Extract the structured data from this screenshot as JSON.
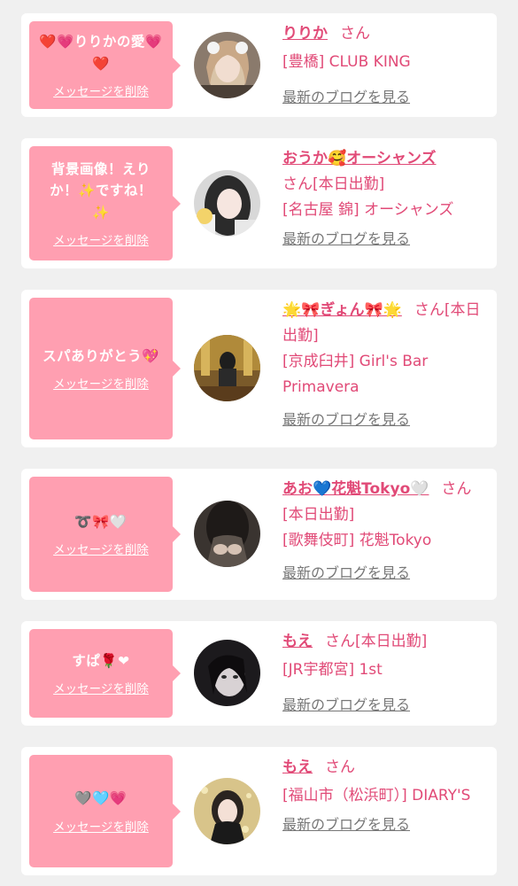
{
  "colors": {
    "page_bg": "#f0f0f0",
    "card_bg": "#ffffff",
    "bubble_bg": "#ff9fb1",
    "accent_text": "#e14a77",
    "link_grey": "#777777"
  },
  "cards": [
    {
      "message": "❤️💗りりかの愛💗❤️",
      "delete_label": "メッセージを削除",
      "girl_name": "りりか",
      "suffix": "さん",
      "shop": "[豊橋] CLUB KING",
      "blog_link": "最新のブログを見る"
    },
    {
      "message": "背景画像！えりか！✨ですね！✨",
      "delete_label": "メッセージを削除",
      "girl_name": "おうか🥰オーシャンズ",
      "suffix": "さん[本日出勤]",
      "shop": "[名古屋 錦] オーシャンズ",
      "blog_link": "最新のブログを見る"
    },
    {
      "message": "スパありがとう💖",
      "delete_label": "メッセージを削除",
      "girl_name": "🌟🎀ぎょん🎀🌟",
      "suffix": "さん[本日出勤]",
      "shop": "[京成臼井] Girl's Bar Primavera",
      "blog_link": "最新のブログを見る"
    },
    {
      "message": "➰🎀🤍",
      "delete_label": "メッセージを削除",
      "girl_name": "あお💙花魁Tokyo🤍",
      "suffix": "さん[本日出勤]",
      "shop": "[歌舞伎町] 花魁Tokyo",
      "blog_link": "最新のブログを見る"
    },
    {
      "message": "すぱ🌹❤",
      "delete_label": "メッセージを削除",
      "girl_name": "もえ",
      "suffix": "さん[本日出勤]",
      "shop": "[JR宇都宮] 1st",
      "blog_link": "最新のブログを見る"
    },
    {
      "message": "🩶🩵💗",
      "delete_label": "メッセージを削除",
      "girl_name": "もえ",
      "suffix": "さん",
      "shop": "[福山市（松浜町）] DIARY'S",
      "blog_link": "最新のブログを見る"
    }
  ]
}
